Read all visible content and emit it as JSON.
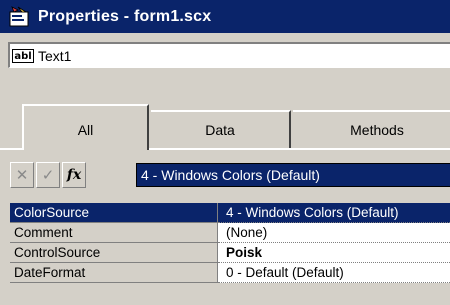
{
  "window": {
    "title": "Properties - form1.scx",
    "icon": "properties-window-icon"
  },
  "object_selector": {
    "icon_text": "abl",
    "value": "Text1"
  },
  "tabs": [
    {
      "label": "All",
      "active": true
    },
    {
      "label": "Data",
      "active": false
    },
    {
      "label": "Methods",
      "active": false
    }
  ],
  "toolbar": {
    "cancel_glyph": "✕",
    "accept_glyph": "✓",
    "fx_glyph": "fx",
    "value_edit": "4 - Windows Colors (Default)"
  },
  "properties": [
    {
      "name": "ColorSource",
      "value": "4 - Windows Colors (Default)",
      "selected": true
    },
    {
      "name": "Comment",
      "value": "(None)"
    },
    {
      "name": "ControlSource",
      "value": "Poisk",
      "bold": true
    },
    {
      "name": "DateFormat",
      "value": "0 - Default (Default)"
    }
  ],
  "colors": {
    "titlebar": "#0a246a",
    "selection": "#0a246a",
    "face": "#d4d0c8"
  }
}
